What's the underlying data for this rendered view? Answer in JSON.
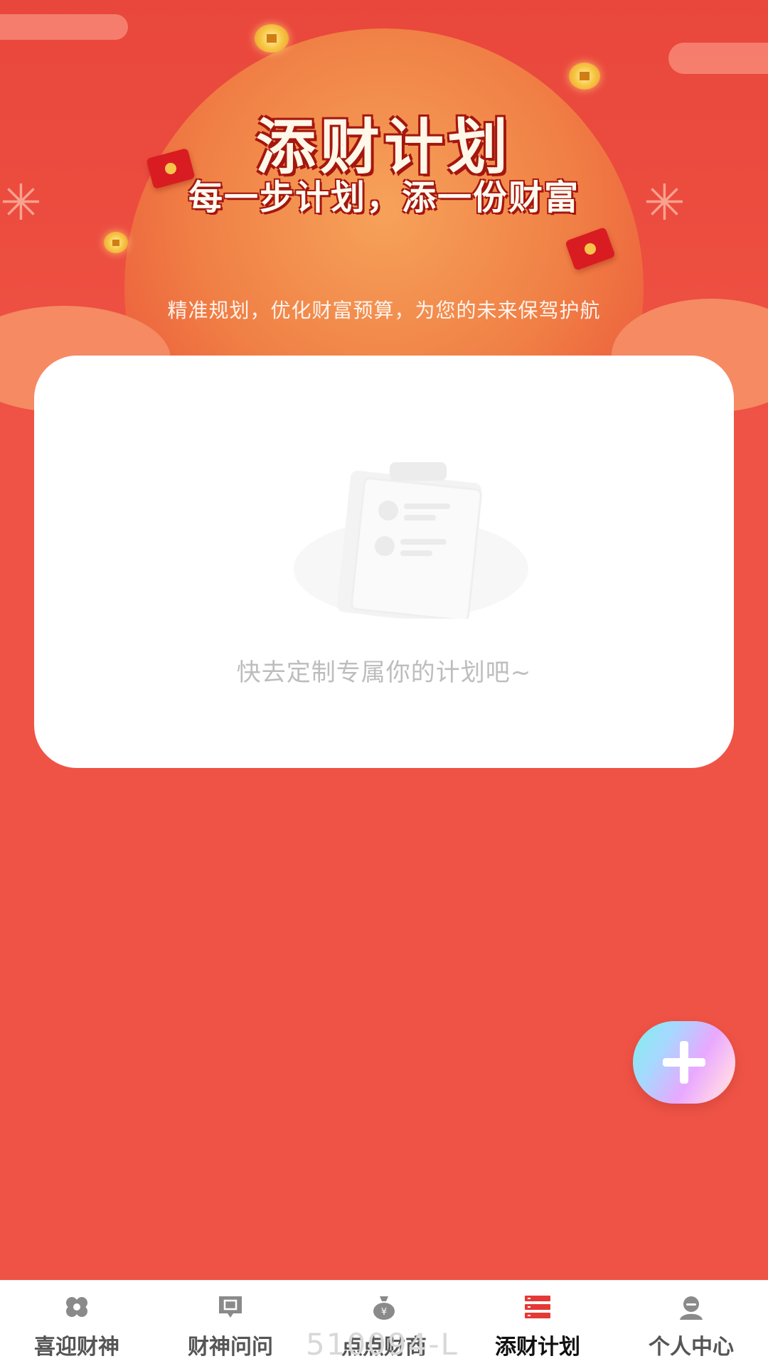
{
  "hero": {
    "title": "添财计划",
    "subtitle": "每一步计划，添一份财富",
    "tagline": "精准规划，优化财富预算，为您的未来保驾护航"
  },
  "empty_state": {
    "message": "快去定制专属你的计划吧~"
  },
  "fab": {
    "icon": "plus-icon"
  },
  "tabbar": {
    "items": [
      {
        "label": "喜迎财神",
        "icon": "fortune-knot-icon"
      },
      {
        "label": "财神问问",
        "icon": "ask-chat-icon"
      },
      {
        "label": "点点财商",
        "icon": "money-bag-icon"
      },
      {
        "label": "添财计划",
        "icon": "plan-list-icon",
        "active": true
      },
      {
        "label": "个人中心",
        "icon": "user-icon"
      }
    ]
  },
  "watermark": "510094-L",
  "colors": {
    "background": "#ef5346",
    "card": "#ffffff",
    "active_tab_icon": "#e53935",
    "inactive_tab_icon": "#8a8a8a"
  }
}
